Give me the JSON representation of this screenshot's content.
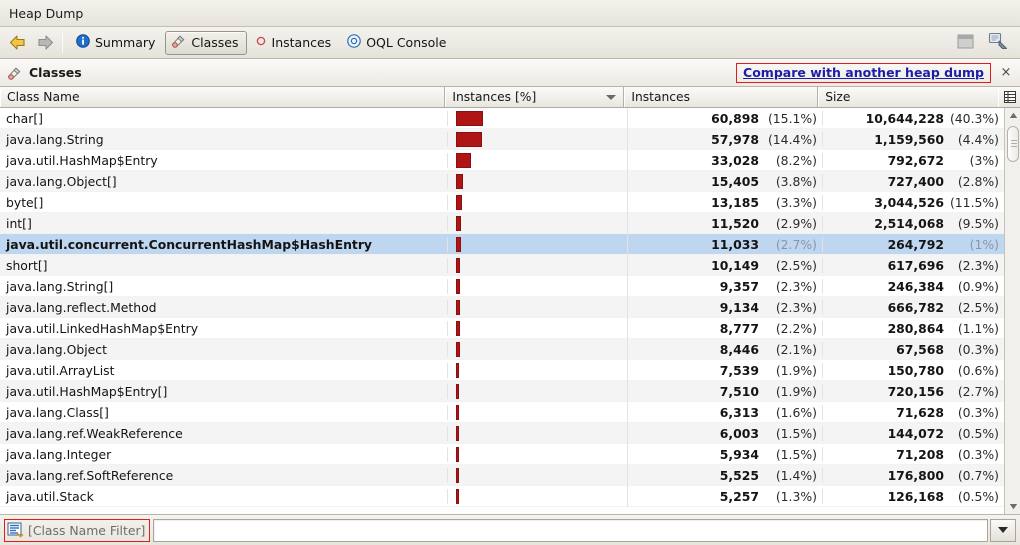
{
  "window": {
    "title": "Heap Dump"
  },
  "toolbar": {
    "back_icon": "back-arrow-icon",
    "forward_icon": "forward-arrow-icon",
    "tabs": [
      {
        "label": "Summary",
        "icon": "info-icon",
        "selected": false
      },
      {
        "label": "Classes",
        "icon": "classes-icon",
        "selected": true
      },
      {
        "label": "Instances",
        "icon": "instances-icon",
        "selected": false
      },
      {
        "label": "OQL Console",
        "icon": "oql-icon",
        "selected": false
      }
    ],
    "right_icons": [
      {
        "name": "window-icon"
      },
      {
        "name": "heap-dump-icon"
      }
    ]
  },
  "subheader": {
    "label": "Classes",
    "icon": "classes-icon",
    "compare_link": "Compare with another heap dump",
    "close_label": "×"
  },
  "table": {
    "columns": [
      {
        "key": "name",
        "label": "Class Name"
      },
      {
        "key": "pct_bar",
        "label": "Instances [%]",
        "sorted": true
      },
      {
        "key": "instances",
        "label": "Instances"
      },
      {
        "key": "size",
        "label": "Size"
      }
    ],
    "column_chooser_icon": "column-chooser-icon",
    "rows": [
      {
        "name": "char[]",
        "bar_pct": 15.1,
        "instances": "60,898",
        "instances_pct": "(15.1%)",
        "size": "10,644,228",
        "size_pct": "(40.3%)",
        "selected": false
      },
      {
        "name": "java.lang.String",
        "bar_pct": 14.4,
        "instances": "57,978",
        "instances_pct": "(14.4%)",
        "size": "1,159,560",
        "size_pct": "(4.4%)",
        "selected": false
      },
      {
        "name": "java.util.HashMap$Entry",
        "bar_pct": 8.2,
        "instances": "33,028",
        "instances_pct": "(8.2%)",
        "size": "792,672",
        "size_pct": "(3%)",
        "selected": false
      },
      {
        "name": "java.lang.Object[]",
        "bar_pct": 3.8,
        "instances": "15,405",
        "instances_pct": "(3.8%)",
        "size": "727,400",
        "size_pct": "(2.8%)",
        "selected": false
      },
      {
        "name": "byte[]",
        "bar_pct": 3.3,
        "instances": "13,185",
        "instances_pct": "(3.3%)",
        "size": "3,044,526",
        "size_pct": "(11.5%)",
        "selected": false
      },
      {
        "name": "int[]",
        "bar_pct": 2.9,
        "instances": "11,520",
        "instances_pct": "(2.9%)",
        "size": "2,514,068",
        "size_pct": "(9.5%)",
        "selected": false
      },
      {
        "name": "java.util.concurrent.ConcurrentHashMap$HashEntry",
        "bar_pct": 2.7,
        "instances": "11,033",
        "instances_pct": "(2.7%)",
        "size": "264,792",
        "size_pct": "(1%)",
        "selected": true
      },
      {
        "name": "short[]",
        "bar_pct": 2.5,
        "instances": "10,149",
        "instances_pct": "(2.5%)",
        "size": "617,696",
        "size_pct": "(2.3%)",
        "selected": false
      },
      {
        "name": "java.lang.String[]",
        "bar_pct": 2.3,
        "instances": "9,357",
        "instances_pct": "(2.3%)",
        "size": "246,384",
        "size_pct": "(0.9%)",
        "selected": false
      },
      {
        "name": "java.lang.reflect.Method",
        "bar_pct": 2.3,
        "instances": "9,134",
        "instances_pct": "(2.3%)",
        "size": "666,782",
        "size_pct": "(2.5%)",
        "selected": false
      },
      {
        "name": "java.util.LinkedHashMap$Entry",
        "bar_pct": 2.2,
        "instances": "8,777",
        "instances_pct": "(2.2%)",
        "size": "280,864",
        "size_pct": "(1.1%)",
        "selected": false
      },
      {
        "name": "java.lang.Object",
        "bar_pct": 2.1,
        "instances": "8,446",
        "instances_pct": "(2.1%)",
        "size": "67,568",
        "size_pct": "(0.3%)",
        "selected": false
      },
      {
        "name": "java.util.ArrayList",
        "bar_pct": 1.9,
        "instances": "7,539",
        "instances_pct": "(1.9%)",
        "size": "150,780",
        "size_pct": "(0.6%)",
        "selected": false
      },
      {
        "name": "java.util.HashMap$Entry[]",
        "bar_pct": 1.9,
        "instances": "7,510",
        "instances_pct": "(1.9%)",
        "size": "720,156",
        "size_pct": "(2.7%)",
        "selected": false
      },
      {
        "name": "java.lang.Class[]",
        "bar_pct": 1.6,
        "instances": "6,313",
        "instances_pct": "(1.6%)",
        "size": "71,628",
        "size_pct": "(0.3%)",
        "selected": false
      },
      {
        "name": "java.lang.ref.WeakReference",
        "bar_pct": 1.5,
        "instances": "6,003",
        "instances_pct": "(1.5%)",
        "size": "144,072",
        "size_pct": "(0.5%)",
        "selected": false
      },
      {
        "name": "java.lang.Integer",
        "bar_pct": 1.5,
        "instances": "5,934",
        "instances_pct": "(1.5%)",
        "size": "71,208",
        "size_pct": "(0.3%)",
        "selected": false
      },
      {
        "name": "java.lang.ref.SoftReference",
        "bar_pct": 1.4,
        "instances": "5,525",
        "instances_pct": "(1.4%)",
        "size": "176,800",
        "size_pct": "(0.7%)",
        "selected": false
      },
      {
        "name": "java.util.Stack",
        "bar_pct": 1.3,
        "instances": "5,257",
        "instances_pct": "(1.3%)",
        "size": "126,168",
        "size_pct": "(0.5%)",
        "selected": false
      }
    ]
  },
  "filter": {
    "icon": "filter-icon",
    "placeholder": "[Class Name Filter]",
    "value": "",
    "dropdown_icon": "chevron-down-icon"
  },
  "colors": {
    "bar": "#b01515",
    "selection": "#bed6f0",
    "link": "#1d1da8",
    "highlight_box": "#e01c1c"
  }
}
